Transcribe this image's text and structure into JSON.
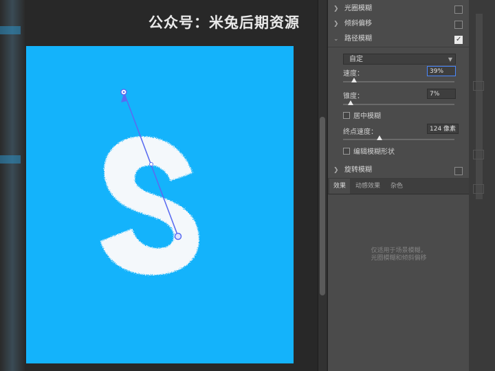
{
  "watermark": "公众号：米兔后期资源",
  "colors": {
    "artboard": "#14b3fb",
    "panel": "#4b4b4b",
    "path": "#5a6cf0"
  },
  "panel": {
    "sections": [
      {
        "label": "光圈模糊",
        "checked": false
      },
      {
        "label": "倾斜偏移",
        "checked": false
      },
      {
        "label": "路径模糊",
        "checked": true,
        "expanded": true
      },
      {
        "label": "旋转模糊",
        "checked": false
      }
    ],
    "path_blur": {
      "preset": "自定",
      "speed_label": "速度：",
      "speed_value": "39%",
      "speed_level": 0.1,
      "taper_label": "锥度：",
      "taper_value": "7%",
      "taper_level": 0.07,
      "centered_label": "居中模糊",
      "end_speed_label": "终点速度：",
      "end_speed_value": "124 像素",
      "end_speed_level": 0.33,
      "edit_shape_label": "编辑模糊形状"
    },
    "tabs": [
      {
        "label": "效果",
        "active": true
      },
      {
        "label": "动感效果",
        "active": false
      },
      {
        "label": "杂色",
        "active": false
      }
    ],
    "note_line1": "仅适用于场景模糊，",
    "note_line2": "光圈模糊和倾斜偏移"
  },
  "icons": {
    "collapsed": "chevron-right-icon",
    "expanded": "chevron-down-icon",
    "dropdown": "chevron-down-icon"
  }
}
